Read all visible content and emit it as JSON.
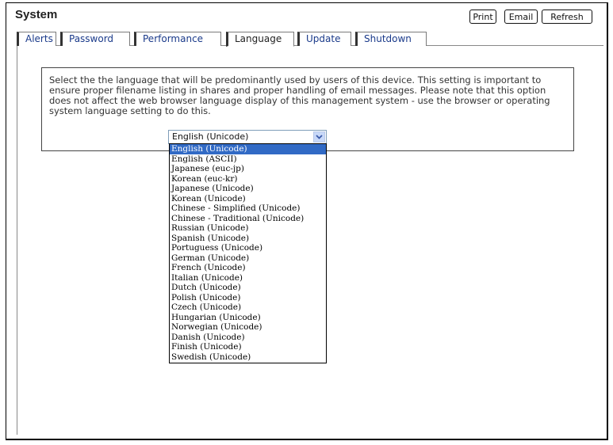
{
  "window": {
    "title": "System"
  },
  "toolbar": {
    "print_label": "Print",
    "email_label": "Email",
    "refresh_label": "Refresh"
  },
  "tabs": [
    {
      "label": "Alerts"
    },
    {
      "label": "Password"
    },
    {
      "label": "Performance"
    },
    {
      "label": "Language",
      "active": true
    },
    {
      "label": "Update"
    },
    {
      "label": "Shutdown"
    }
  ],
  "language": {
    "description": "Select the the language that will be predominantly used by users of this device. This setting is important to ensure proper filename listing in shares and proper handling of email messages. Please note that this option does not affect the web browser language display of this management system - use the browser or operating system language setting to do this.",
    "selected": "English (Unicode)",
    "options": [
      "English (Unicode)",
      "English (ASCII)",
      "Japanese (euc-jp)",
      "Korean (euc-kr)",
      "Japanese (Unicode)",
      "Korean (Unicode)",
      "Chinese - Simplified (Unicode)",
      "Chinese - Traditional (Unicode)",
      "Russian (Unicode)",
      "Spanish (Unicode)",
      "Portuguess (Unicode)",
      "German (Unicode)",
      "French (Unicode)",
      "Italian (Unicode)",
      "Dutch (Unicode)",
      "Polish (Unicode)",
      "Czech (Unicode)",
      "Hungarian (Unicode)",
      "Norwegian (Unicode)",
      "Danish (Unicode)",
      "Finish (Unicode)",
      "Swedish (Unicode)"
    ]
  },
  "colors": {
    "selected_option": "#316ac5",
    "tab_link": "#1a3a8a",
    "select_arrow": "#c8d8f8"
  },
  "icons": {
    "select_arrow": "chevron-down-icon"
  }
}
